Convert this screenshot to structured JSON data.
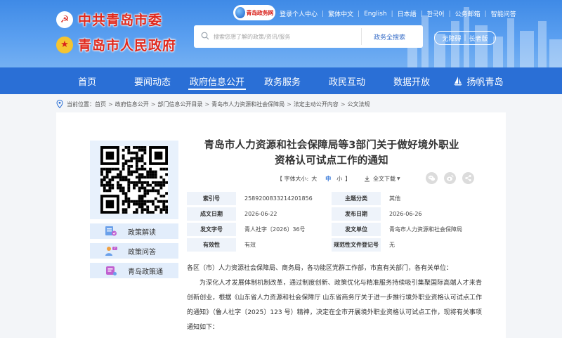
{
  "header": {
    "party_name": "中共青岛市委",
    "gov_name": "青岛市人民政府",
    "portal_logo": "青岛政务网",
    "emblem_party": "☭",
    "emblem_nation": "★",
    "toplinks": [
      "登录个人中心",
      "繁体中文",
      "English",
      "日本語",
      "한국어",
      "公务邮箱",
      "智能问答"
    ],
    "search": {
      "placeholder": "搜索您想了解的政策/资讯/服务",
      "button": "政务全搜索"
    },
    "accessibility": {
      "barrier_free": "无障碍",
      "elder_mode": "长者版"
    }
  },
  "nav": {
    "items": [
      {
        "label": "首页"
      },
      {
        "label": "要闻动态"
      },
      {
        "label": "政府信息公开",
        "active": true
      },
      {
        "label": "政务服务"
      },
      {
        "label": "政民互动"
      },
      {
        "label": "数据开放"
      },
      {
        "label": "扬帆青岛"
      }
    ]
  },
  "breadcrumb": {
    "prefix": "当前位置：",
    "items": [
      "首页",
      "政府信息公开",
      "部门信息公开目录",
      "青岛市人力资源和社会保障局",
      "法定主动公开内容",
      "公文法规"
    ]
  },
  "sidebar": {
    "items": [
      {
        "label": "政策解读",
        "icon": "policy-reading-icon"
      },
      {
        "label": "政策问答",
        "icon": "policy-qa-icon"
      },
      {
        "label": "青岛政策通",
        "icon": "policy-link-icon"
      }
    ]
  },
  "article": {
    "title_line1": "青岛市人力资源和社会保障局等3部门关于做好境外职业",
    "title_line2": "资格认可试点工作的通知",
    "font_size_label": "【 字体大小:",
    "font_sizes": [
      "大",
      "中",
      "小"
    ],
    "font_size_close": "】",
    "download_label": "全文下载",
    "meta": [
      {
        "k1": "索引号",
        "v1": "2589200833214201856",
        "k2": "主题分类",
        "v2": "其他"
      },
      {
        "k1": "成文日期",
        "v1": "2026-06-22",
        "k2": "发布日期",
        "v2": "2026-06-26"
      },
      {
        "k1": "发文字号",
        "v1": "青人社字〔2026〕36号",
        "k2": "发文单位",
        "v2": "青岛市人力资源和社会保障局"
      },
      {
        "k1": "有效性",
        "v1": "有效",
        "k2": "规范性文件登记号",
        "v2": "无"
      }
    ],
    "body_p1": "各区（市）人力资源社会保障局、商务局，各功能区党群工作部，市直有关部门，各有关单位：",
    "body_p2": "为深化人才发展体制机制改革，通过制度创新、政策优化与精准服务持续吸引集聚国际高端人才来青创新创业，根据《山东省人力资源和社会保障厅 山东省商务厅关于进一步推行境外职业资格认可试点工作的通知》（鲁人社字〔2025〕123 号）精神，决定在全市开展境外职业资格认可试点工作，现将有关事项通知如下："
  },
  "colors": {
    "nav_bg": "#2a6fd6",
    "header_bg": "#4a90e8",
    "accent_red": "#e02a1e",
    "sidebar_bg": "#e2edfb"
  }
}
